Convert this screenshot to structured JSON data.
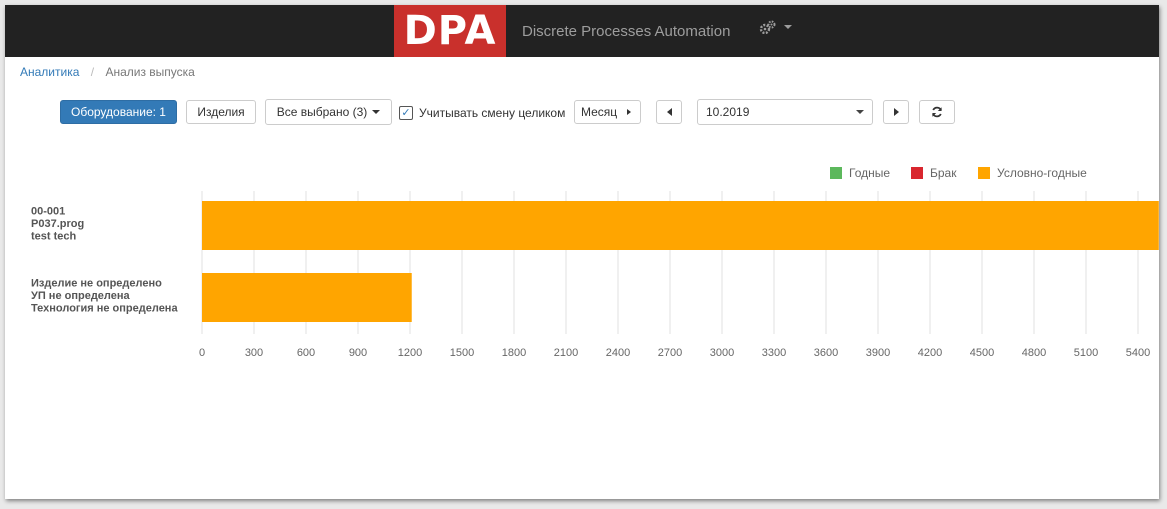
{
  "navbar": {
    "logo_text": "DPA",
    "brand_name": "Discrete Processes Automation",
    "menu_icon": "cogs-icon"
  },
  "breadcrumb": {
    "items": [
      "Аналитика",
      "Анализ выпуска"
    ]
  },
  "toolbar": {
    "equipment_label": "Оборудование: 1",
    "products_label": "Изделия",
    "selected_label": "Все выбрано (3)",
    "whole_shift_label": "Учитывать смену целиком",
    "whole_shift_checked": true,
    "period_label": "Месяц",
    "prev_icon": "triangle-left-icon",
    "next_icon": "triangle-right-icon",
    "date_value": "10.2019",
    "refresh_icon": "refresh-icon"
  },
  "legend": [
    {
      "label": "Годные",
      "color": "#5cb85c"
    },
    {
      "label": "Брак",
      "color": "#d9262e"
    },
    {
      "label": "Условно-годные",
      "color": "#ffa500"
    }
  ],
  "chart_data": {
    "type": "bar",
    "orientation": "horizontal",
    "stacked": true,
    "categories": [
      [
        "00-001",
        "P037.prog",
        "test tech"
      ],
      [
        "Изделие не определено",
        "УП не определена",
        "Технология не определена"
      ]
    ],
    "series": [
      {
        "name": "Годные",
        "color": "#5cb85c",
        "values": [
          0,
          0
        ]
      },
      {
        "name": "Брак",
        "color": "#d9262e",
        "values": [
          0,
          0
        ]
      },
      {
        "name": "Условно-годные",
        "color": "#ffa500",
        "values": [
          5520,
          1210
        ]
      }
    ],
    "xticks": [
      0,
      300,
      600,
      900,
      1200,
      1500,
      1800,
      2100,
      2400,
      2700,
      3000,
      3300,
      3600,
      3900,
      4200,
      4500,
      4800,
      5100,
      5400
    ],
    "xlim": [
      0,
      5520
    ],
    "grid": true,
    "legend_position": "top-right"
  }
}
